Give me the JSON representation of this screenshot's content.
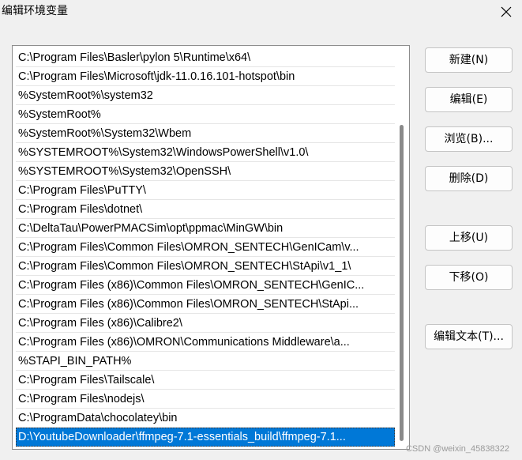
{
  "window": {
    "title": "编辑环境变量",
    "close_icon": "close-icon"
  },
  "path_list": {
    "items": [
      "C:\\Program Files\\Basler\\pylon 5\\Runtime\\x64\\",
      "C:\\Program Files\\Microsoft\\jdk-11.0.16.101-hotspot\\bin",
      "%SystemRoot%\\system32",
      "%SystemRoot%",
      "%SystemRoot%\\System32\\Wbem",
      "%SYSTEMROOT%\\System32\\WindowsPowerShell\\v1.0\\",
      "%SYSTEMROOT%\\System32\\OpenSSH\\",
      "C:\\Program Files\\PuTTY\\",
      "C:\\Program Files\\dotnet\\",
      "C:\\DeltaTau\\PowerPMACSim\\opt\\ppmac\\MinGW\\bin",
      "C:\\Program Files\\Common Files\\OMRON_SENTECH\\GenICam\\v...",
      "C:\\Program Files\\Common Files\\OMRON_SENTECH\\StApi\\v1_1\\",
      "C:\\Program Files (x86)\\Common Files\\OMRON_SENTECH\\GenIC...",
      "C:\\Program Files (x86)\\Common Files\\OMRON_SENTECH\\StApi...",
      "C:\\Program Files (x86)\\Calibre2\\",
      "C:\\Program Files (x86)\\OMRON\\Communications Middleware\\a...",
      "%STAPI_BIN_PATH%",
      "C:\\Program Files\\Tailscale\\",
      "C:\\Program Files\\nodejs\\",
      "C:\\ProgramData\\chocolatey\\bin",
      "D:\\YoutubeDownloader\\ffmpeg-7.1-essentials_build\\ffmpeg-7.1..."
    ],
    "selected_index": 20
  },
  "buttons": {
    "new": "新建(N)",
    "edit": "编辑(E)",
    "browse": "浏览(B)...",
    "delete": "删除(D)",
    "move_up": "上移(U)",
    "move_down": "下移(O)",
    "edit_text": "编辑文本(T)..."
  },
  "watermark": "CSDN @weixin_45838322",
  "colors": {
    "selection": "#0078d7",
    "background": "#f0f0f0"
  }
}
